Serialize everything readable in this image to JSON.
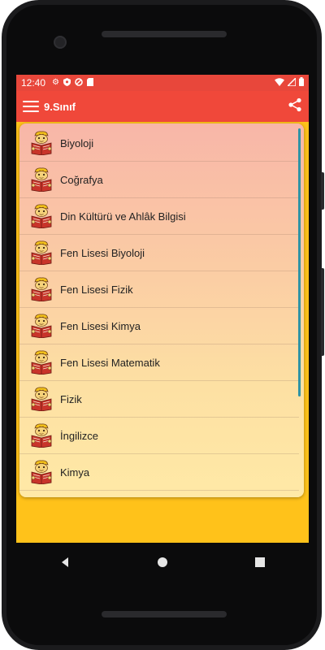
{
  "status_bar": {
    "time": "12:40",
    "left_icons": [
      "settings-icon",
      "shield-icon",
      "data-saver-icon",
      "sd-card-icon"
    ],
    "right_icons": [
      "wifi-icon",
      "signal-icon",
      "battery-icon"
    ]
  },
  "app_bar": {
    "title": "9.Sınıf",
    "menu_icon": "hamburger-menu-icon",
    "share_icon": "share-icon"
  },
  "list": {
    "item_icon": "reading-student-icon",
    "items": [
      {
        "label": "Biyoloji"
      },
      {
        "label": "Coğrafya"
      },
      {
        "label": "Din Kültürü ve Ahlâk Bilgisi"
      },
      {
        "label": "Fen Lisesi Biyoloji"
      },
      {
        "label": "Fen Lisesi Fizik"
      },
      {
        "label": "Fen Lisesi Kimya"
      },
      {
        "label": "Fen Lisesi Matematik"
      },
      {
        "label": "Fizik"
      },
      {
        "label": "İngilizce"
      },
      {
        "label": "Kimya"
      }
    ]
  },
  "nav_bar": {
    "buttons": [
      "back-icon",
      "home-icon",
      "recents-icon"
    ]
  },
  "colors": {
    "status_bar": "#e8473b",
    "app_bar": "#f0483a",
    "background": "#ffc21a",
    "list_top": "#f8b6a8",
    "list_bottom": "#ffe9a6",
    "scrollbar": "#2f93a5"
  }
}
